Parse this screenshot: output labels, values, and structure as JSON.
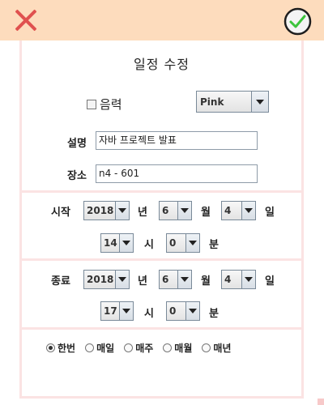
{
  "dialog": {
    "title": "일정 수정",
    "close_icon": "close-x-icon",
    "confirm_icon": "check-circle-icon"
  },
  "options": {
    "lunar_label": "음력",
    "lunar_checked": false,
    "color_value": "Pink"
  },
  "description": {
    "label": "설명",
    "value": "자바 프로젝트 발표"
  },
  "location": {
    "label": "장소",
    "value": "n4 - 601"
  },
  "start": {
    "label": "시작",
    "year": "2018",
    "year_unit": "년",
    "month": "6",
    "month_unit": "월",
    "day": "4",
    "day_unit": "일",
    "hour": "14",
    "hour_unit": "시",
    "minute": "0",
    "minute_unit": "분"
  },
  "end": {
    "label": "종료",
    "year": "2018",
    "year_unit": "년",
    "month": "6",
    "month_unit": "월",
    "day": "4",
    "day_unit": "일",
    "hour": "17",
    "hour_unit": "시",
    "minute": "0",
    "minute_unit": "분"
  },
  "repeat": {
    "selected": "한번",
    "options": [
      "한번",
      "매일",
      "매주",
      "매월",
      "매년"
    ]
  },
  "colors": {
    "header_bg": "#fddcbd",
    "close_red": "#e0514f",
    "confirm_green": "#3cc43c",
    "panel_border": "#fbe3e3"
  }
}
